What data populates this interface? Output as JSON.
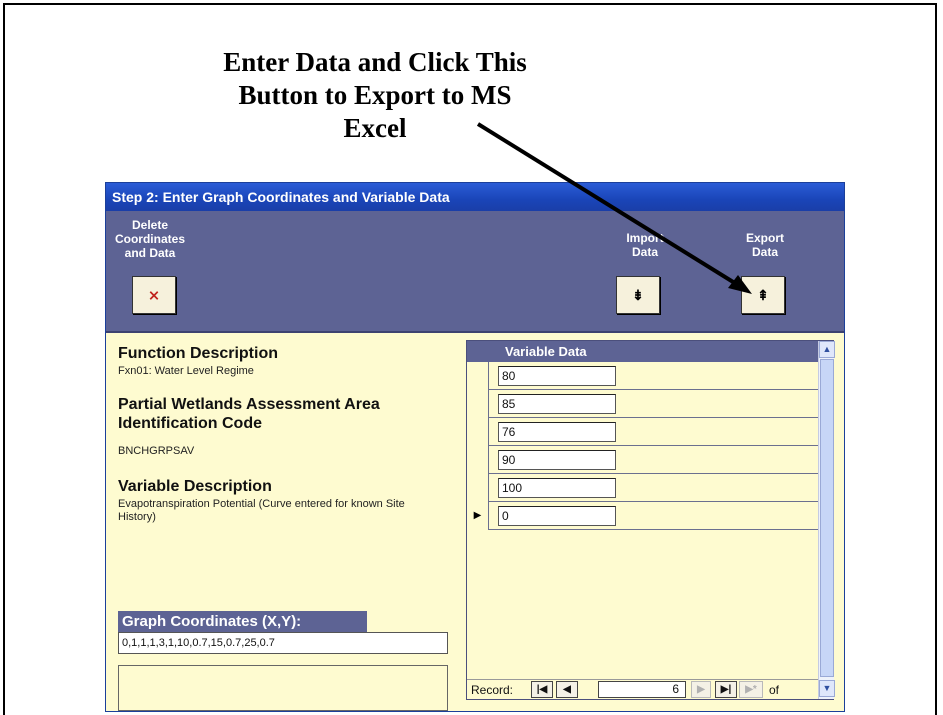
{
  "callout": {
    "lines": [
      "Enter Data and Click This",
      "Button to Export to MS",
      "Excel"
    ]
  },
  "window": {
    "title": "Step 2: Enter Graph Coordinates and Variable Data"
  },
  "toolbar": {
    "delete_label": "Delete\nCoordinates\nand Data",
    "import_label": "Import\nData",
    "export_label": "Export\nData"
  },
  "form": {
    "function_heading": "Function Description",
    "function_value": "Fxn01:  Water Level Regime",
    "pwaa_heading": "Partial Wetlands Assessment Area Identification Code",
    "pwaa_value": "BNCHGRPSAV",
    "variable_heading": "Variable Description",
    "variable_value": "Evapotranspiration Potential (Curve entered for known Site History)",
    "coords_heading": "Graph Coordinates (X,Y):",
    "coords_value": "0,1,1,1,3,1,10,0.7,15,0.7,25,0.7"
  },
  "subform": {
    "header": "Variable Data",
    "rows": [
      "80",
      "85",
      "76",
      "90",
      "100",
      "0"
    ],
    "current_row_index": 5
  },
  "navigator": {
    "record_label": "Record:",
    "current_record": "6",
    "of_label": "of"
  },
  "icons": {
    "delete": "delete-x-icon",
    "import": "import-icon",
    "export": "export-icon"
  },
  "colors": {
    "titlebar": "#1a45b8",
    "header_band": "#5d6394",
    "form_background": "#fefbd0"
  }
}
